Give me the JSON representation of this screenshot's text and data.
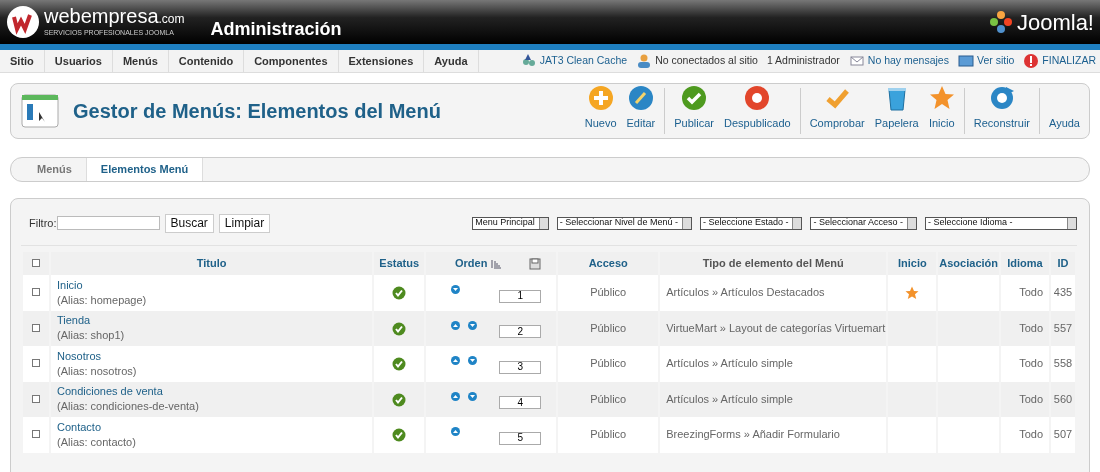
{
  "header": {
    "logo_name": "webempresa",
    "logo_suffix": ".com",
    "logo_tagline": "SERVICIOS PROFESIONALES JOOMLA",
    "title": "Administración",
    "brand": "Joomla!"
  },
  "menu": {
    "items": [
      "Sitio",
      "Usuarios",
      "Menús",
      "Contenido",
      "Componentes",
      "Extensiones",
      "Ayuda"
    ],
    "status": [
      {
        "text": "JAT3 Clean Cache",
        "kind": "link"
      },
      {
        "text": "No conectados al sitio",
        "kind": "plain"
      },
      {
        "text": "1 Administrador",
        "kind": "plain"
      },
      {
        "text": "No hay mensajes",
        "kind": "link"
      },
      {
        "text": "Ver sitio",
        "kind": "link"
      },
      {
        "text": "FINALIZAR",
        "kind": "link"
      }
    ]
  },
  "toolbar": {
    "title": "Gestor de Menús: Elementos del Menú",
    "buttons": [
      "Nuevo",
      "Editar",
      "Publicar",
      "Despublicado",
      "Comprobar",
      "Papelera",
      "Inicio",
      "Reconstruir",
      "Ayuda"
    ]
  },
  "tabs": [
    {
      "label": "Menús",
      "selected": false
    },
    {
      "label": "Elementos Menú",
      "selected": true
    }
  ],
  "filter": {
    "label": "Filtro:",
    "buttons": [
      "Buscar",
      "Limpiar"
    ],
    "selects": [
      "Menu Principal",
      "- Seleccionar Nivel de Menú -",
      "- Seleccione Estado -",
      "- Seleccionar Acceso -",
      "- Seleccione Idioma -"
    ]
  },
  "table": {
    "all_checked": false,
    "columns": [
      {
        "label": "Titulo",
        "kind": "link"
      },
      {
        "label": "Estatus",
        "kind": "link"
      },
      {
        "label": "Orden",
        "kind": "sort"
      },
      {
        "label": "Acceso",
        "kind": "link"
      },
      {
        "label": "Tipo de elemento del Menú",
        "kind": "plain"
      },
      {
        "label": "Inicio",
        "kind": "link"
      },
      {
        "label": "Asociación",
        "kind": "link"
      },
      {
        "label": "Idioma",
        "kind": "link"
      },
      {
        "label": "ID",
        "kind": "link"
      }
    ],
    "rows": [
      {
        "checked": false,
        "title": "Inicio",
        "alias": "(Alias: homepage)",
        "published": true,
        "up": false,
        "down": true,
        "order": "1",
        "access": "Público",
        "type": "Artículos » Artículos Destacados",
        "home": true,
        "language": "Todo",
        "id": "435"
      },
      {
        "checked": false,
        "title": "Tienda",
        "alias": "(Alias: shop1)",
        "published": true,
        "up": true,
        "down": true,
        "order": "2",
        "access": "Público",
        "type": "VirtueMart » Layout de categorías Virtuemart",
        "home": false,
        "language": "Todo",
        "id": "557"
      },
      {
        "checked": false,
        "title": "Nosotros",
        "alias": "(Alias: nosotros)",
        "published": true,
        "up": true,
        "down": true,
        "order": "3",
        "access": "Público",
        "type": "Artículos » Artículo simple",
        "home": false,
        "language": "Todo",
        "id": "558"
      },
      {
        "checked": false,
        "title": "Condiciones de venta",
        "alias": "(Alias: condiciones-de-venta)",
        "published": true,
        "up": true,
        "down": true,
        "order": "4",
        "access": "Público",
        "type": "Artículos » Artículo simple",
        "home": false,
        "language": "Todo",
        "id": "560"
      },
      {
        "checked": false,
        "title": "Contacto",
        "alias": "(Alias: contacto)",
        "published": true,
        "up": true,
        "down": false,
        "order": "5",
        "access": "Público",
        "type": "BreezingForms » Añadir Formulario",
        "home": false,
        "language": "Todo",
        "id": "507"
      }
    ]
  }
}
